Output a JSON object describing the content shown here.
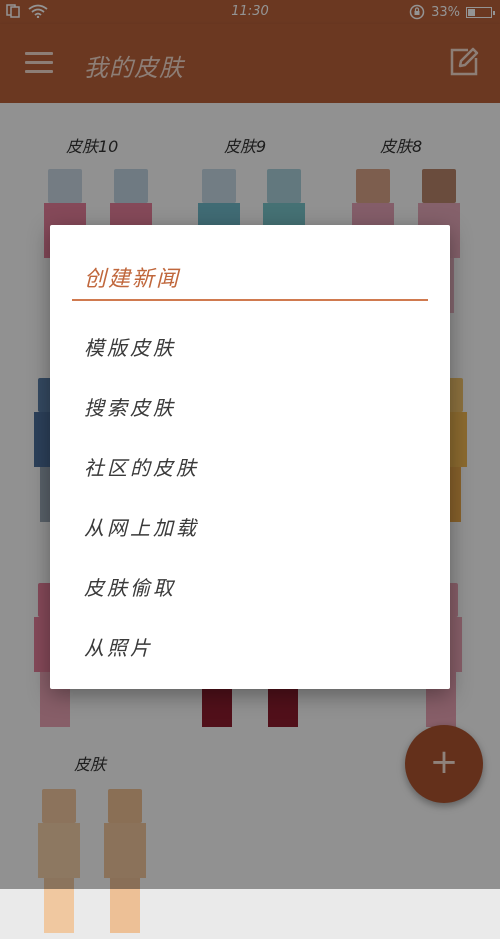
{
  "status_bar": {
    "time": "11:30",
    "battery": "33%",
    "battery_level": 0.33
  },
  "app_bar": {
    "title": "我的皮肤"
  },
  "skins": {
    "row1": [
      "皮肤10",
      "皮肤9",
      "皮肤8"
    ],
    "row3": [
      "皮肤"
    ]
  },
  "dialog": {
    "title": "创建新闻",
    "options": [
      "模版皮肤",
      "搜索皮肤",
      "社区的皮肤",
      "从网上加载",
      "皮肤偷取",
      "从照片"
    ]
  },
  "fab": {
    "icon": "plus-icon",
    "label": "+"
  },
  "colors": {
    "accent": "#b8613a",
    "fab": "#ad5330",
    "dialog_title": "#c0673c"
  }
}
